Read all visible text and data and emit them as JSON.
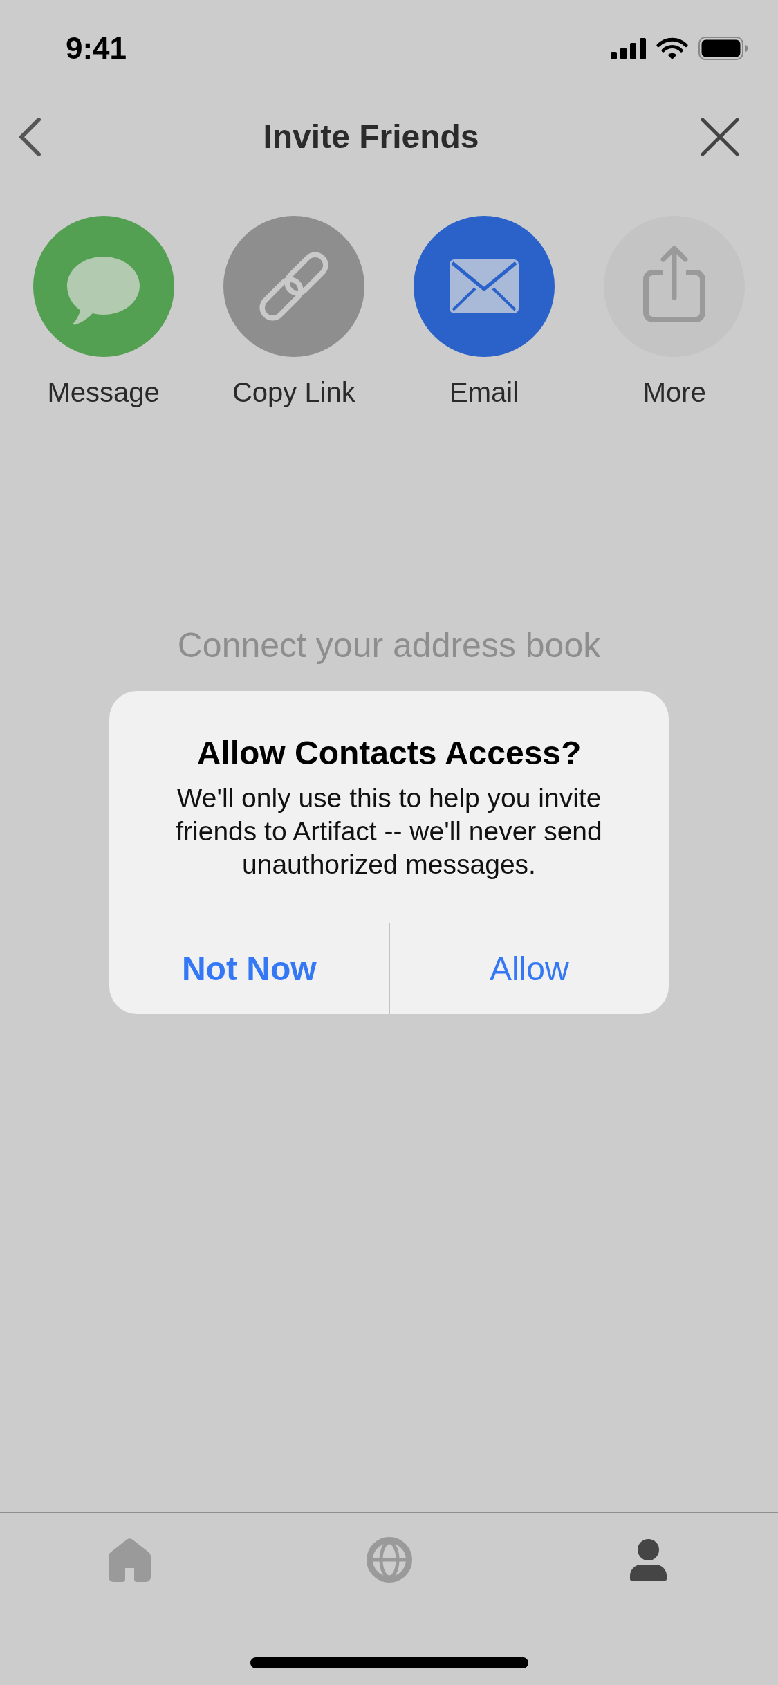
{
  "status_bar": {
    "time": "9:41"
  },
  "header": {
    "title": "Invite Friends"
  },
  "share_options": [
    {
      "kind": "message",
      "label": "Message",
      "color": "#54a052"
    },
    {
      "kind": "link",
      "label": "Copy Link",
      "color": "#8e8e8f"
    },
    {
      "kind": "email",
      "label": "Email",
      "color": "#2a62c9"
    },
    {
      "kind": "share",
      "label": "More",
      "color": "#c4c4c4"
    }
  ],
  "empty_state": {
    "message": "Connect your address book"
  },
  "dialog": {
    "title": "Allow Contacts Access?",
    "message": "We'll only use this to help you invite friends to Artifact -- we'll never send unauthorized messages.",
    "buttons": [
      {
        "label": "Not Now",
        "emphasized": true
      },
      {
        "label": "Allow",
        "emphasized": false
      }
    ]
  },
  "tab_bar": [
    {
      "kind": "home",
      "selected": false
    },
    {
      "kind": "globe",
      "selected": false
    },
    {
      "kind": "profile",
      "selected": true
    }
  ]
}
